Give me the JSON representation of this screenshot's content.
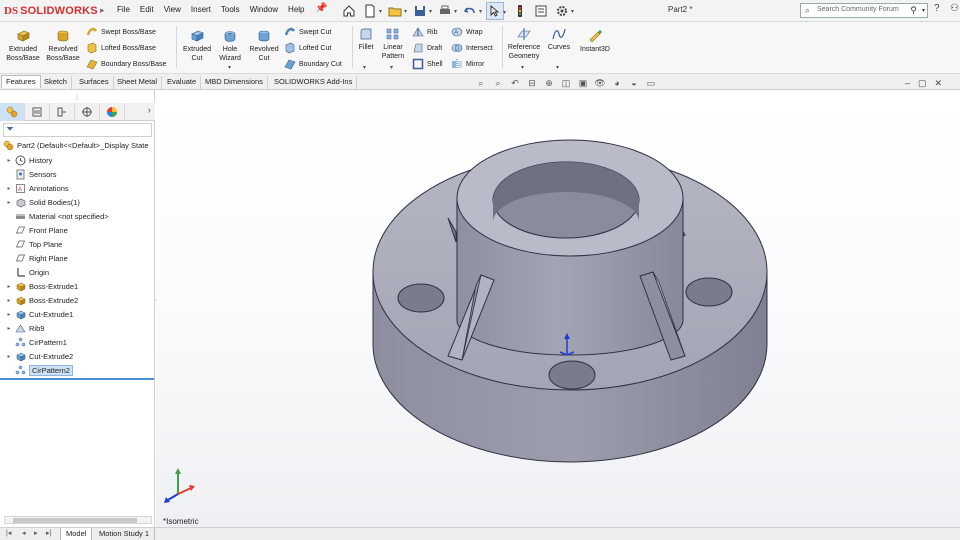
{
  "app": {
    "logo_ds": "DS",
    "logo_text": "SOLIDWORKS",
    "document_title": "Part2 *"
  },
  "menu": {
    "items": [
      "File",
      "Edit",
      "View",
      "Insert",
      "Tools",
      "Window",
      "Help"
    ]
  },
  "search": {
    "placeholder": "Search Community Forum"
  },
  "ribbon": {
    "extruded_boss": "Extruded Boss/Base",
    "revolved_boss": "Revolved Boss/Base",
    "swept_boss": "Swept Boss/Base",
    "lofted_boss": "Lofted Boss/Base",
    "boundary_boss": "Boundary Boss/Base",
    "extruded_cut": "Extruded Cut",
    "hole_wizard": "Hole Wizard",
    "revolved_cut": "Revolved Cut",
    "swept_cut": "Swept Cut",
    "lofted_cut": "Lofted Cut",
    "boundary_cut": "Boundary Cut",
    "fillet": "Fillet",
    "linear_pattern": "Linear Pattern",
    "rib": "Rib",
    "draft": "Draft",
    "shell": "Shell",
    "wrap": "Wrap",
    "intersect": "Intersect",
    "mirror": "Mirror",
    "reference_geometry": "Reference Geometry",
    "curves": "Curves",
    "instant3d": "Instant3D"
  },
  "command_tabs": [
    "Features",
    "Sketch",
    "Surfaces",
    "Sheet Metal",
    "Evaluate",
    "MBD Dimensions",
    "SOLIDWORKS Add-Ins"
  ],
  "feature_tree": {
    "root": "Part2  (Default<<Default>_Display State",
    "items": [
      {
        "label": "History",
        "icon": "history-icon",
        "expandable": true
      },
      {
        "label": "Sensors",
        "icon": "sensors-icon",
        "expandable": false
      },
      {
        "label": "Annotations",
        "icon": "annotations-icon",
        "expandable": true
      },
      {
        "label": "Solid Bodies(1)",
        "icon": "solid-bodies-icon",
        "expandable": true
      },
      {
        "label": "Material <not specified>",
        "icon": "material-icon",
        "expandable": false
      },
      {
        "label": "Front Plane",
        "icon": "plane-icon",
        "expandable": false
      },
      {
        "label": "Top Plane",
        "icon": "plane-icon",
        "expandable": false
      },
      {
        "label": "Right Plane",
        "icon": "plane-icon",
        "expandable": false
      },
      {
        "label": "Origin",
        "icon": "origin-icon",
        "expandable": false
      },
      {
        "label": "Boss-Extrude1",
        "icon": "extrude-icon",
        "expandable": true
      },
      {
        "label": "Boss-Extrude2",
        "icon": "extrude-icon",
        "expandable": true
      },
      {
        "label": "Cut-Extrude1",
        "icon": "cut-extrude-icon",
        "expandable": true
      },
      {
        "label": "Rib9",
        "icon": "rib-icon",
        "expandable": true
      },
      {
        "label": "CirPattern1",
        "icon": "circular-pattern-icon",
        "expandable": false
      },
      {
        "label": "Cut-Extrude2",
        "icon": "cut-extrude-icon",
        "expandable": true
      },
      {
        "label": "CirPattern2",
        "icon": "circular-pattern-icon",
        "expandable": false,
        "selected": true
      }
    ]
  },
  "viewport": {
    "view_label": "*Isometric"
  },
  "bottom_tabs": [
    "Model",
    "Motion Study 1"
  ],
  "colors": {
    "brand": "#d32f2f",
    "model_face": "#a9abb9",
    "model_side": "#8e90a0",
    "selection": "#cde3f5"
  }
}
